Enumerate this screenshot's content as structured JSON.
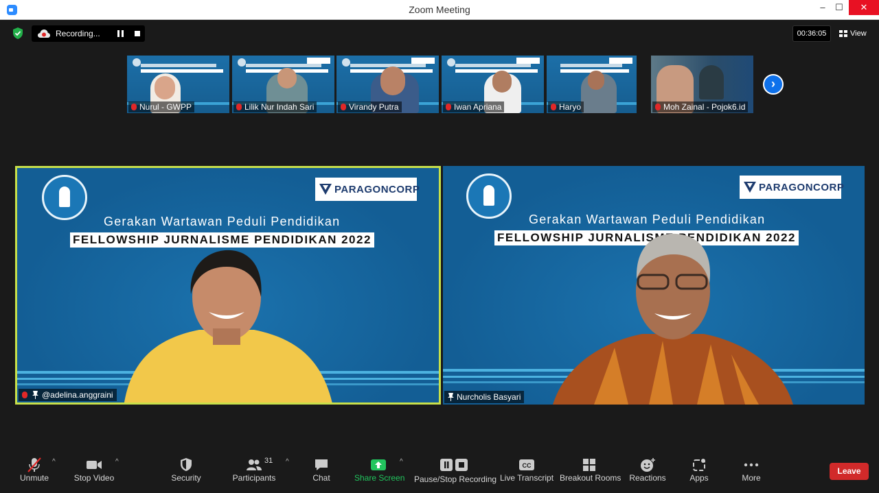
{
  "window": {
    "title": "Zoom Meeting",
    "min": "–",
    "max": "☐",
    "close": "✕"
  },
  "top": {
    "recording_label": "Recording...",
    "timer": "00:36:05",
    "view_label": "View"
  },
  "thumbnails": [
    {
      "name": "Nurul - GWPP"
    },
    {
      "name": "Lilik Nur Indah Sari"
    },
    {
      "name": "Virandy Putra"
    },
    {
      "name": "Iwan Apriana"
    },
    {
      "name": "Haryo"
    },
    {
      "name": "Moh Zainal - Pojok6.id"
    }
  ],
  "next_label": "›",
  "main_tiles": [
    {
      "name": "@adelina.anggraini",
      "logo_text": "PARAGONCORP",
      "headline": "Gerakan Wartawan Peduli Pendidikan",
      "subline": "FELLOWSHIP JURNALISME PENDIDIKAN 2022"
    },
    {
      "name": "Nurcholis Basyari",
      "logo_text": "PARAGONCORP",
      "headline": "Gerakan Wartawan Peduli Pendidikan",
      "subline": "FELLOWSHIP JURNALISME PENDIDIKAN 2022"
    }
  ],
  "toolbar": {
    "unmute": "Unmute",
    "stop_video": "Stop Video",
    "security": "Security",
    "participants": "Participants",
    "participant_count": "31",
    "chat": "Chat",
    "share_screen": "Share Screen",
    "pause_stop_recording": "Pause/Stop Recording",
    "live_transcript": "Live Transcript",
    "breakout_rooms": "Breakout Rooms",
    "reactions": "Reactions",
    "apps": "Apps",
    "more": "More",
    "leave": "Leave",
    "caret": "^"
  },
  "colors": {
    "active_speaker_border": "#c8e04a",
    "share_green": "#22c55e",
    "leave_red": "#d12a2a",
    "background_blue": "#13629a"
  }
}
